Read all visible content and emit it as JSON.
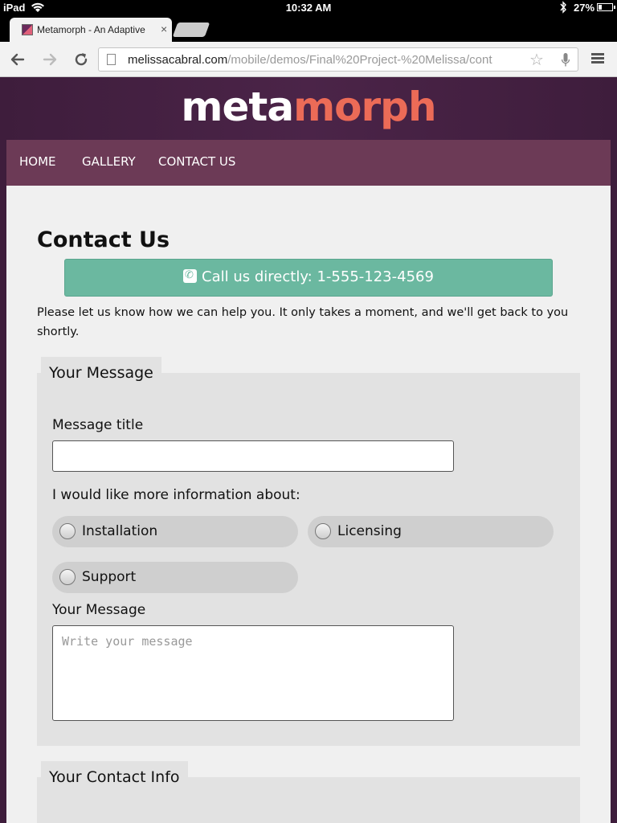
{
  "status_bar": {
    "device": "iPad",
    "time": "10:32 AM",
    "battery": "27%",
    "battery_level": 0.27
  },
  "browser": {
    "tab_title": "Metamorph - An Adaptive",
    "close_glyph": "×",
    "url_host": "melissacabral.com",
    "url_path": "/mobile/demos/Final%20Project-%20Melissa/cont"
  },
  "site": {
    "logo_part1": "meta",
    "logo_part2": "morph",
    "nav": [
      "HOME",
      "GALLERY",
      "CONTACT US"
    ]
  },
  "contact": {
    "title": "Contact Us",
    "call_label": "Call us directly: 1-555-123-4569",
    "intro": "Please let us know how we can help you. It only takes a moment, and we'll get back to you shortly."
  },
  "message_section": {
    "legend": "Your Message",
    "title_label": "Message title",
    "title_value": "",
    "info_label": "I would like more information about:",
    "options": [
      "Installation",
      "Licensing",
      "Support"
    ],
    "message_label": "Your Message",
    "message_placeholder": "Write your message",
    "message_value": ""
  },
  "contact_section": {
    "legend": "Your Contact Info"
  },
  "colors": {
    "page_bg": "#4b2448",
    "nav_bg": "#6c3a56",
    "call_button": "#6bb8a0",
    "logo_accent": "#ec6b57"
  },
  "icons": [
    "wifi-icon",
    "bluetooth-icon",
    "battery-icon",
    "favicon",
    "back-icon",
    "forward-icon",
    "reload-icon",
    "page-icon",
    "star-icon",
    "mic-icon",
    "menu-icon",
    "phone-icon"
  ]
}
